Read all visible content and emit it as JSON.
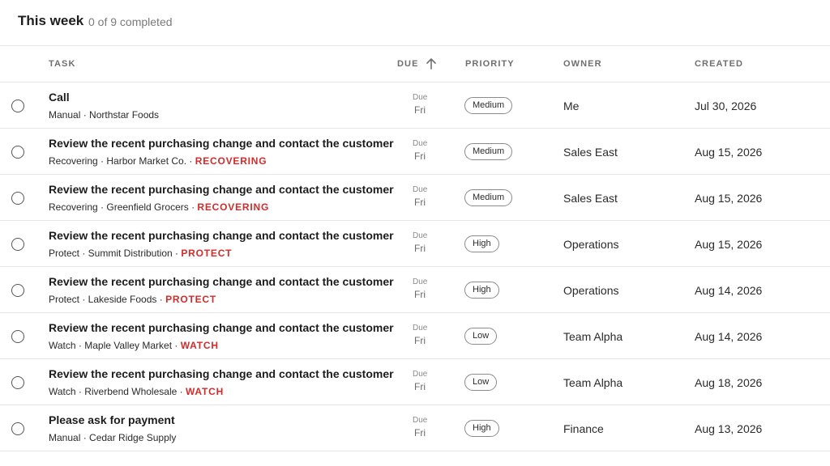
{
  "header": {
    "title": "This week",
    "count": "0 of 9 completed"
  },
  "columns": {
    "task": "TASK",
    "due": "DUE",
    "priority": "PRIORITY",
    "owner": "OWNER",
    "created": "CREATED",
    "sort_icon": "arrow-up-icon"
  },
  "rows": [
    {
      "title": "Call",
      "sub": "Manual · Northstar Foods",
      "tag": "",
      "due_label": "Due",
      "due_day": "Fri",
      "priority": "Medium",
      "owner": "Me",
      "created": "Jul 30, 2026"
    },
    {
      "title": "Review the recent purchasing change and contact the customer",
      "sub": "Recovering · Harbor Market Co. · ",
      "tag": "RECOVERING",
      "due_label": "Due",
      "due_day": "Fri",
      "priority": "Medium",
      "owner": "Sales East",
      "created": "Aug 15, 2026"
    },
    {
      "title": "Review the recent purchasing change and contact the customer",
      "sub": "Recovering · Greenfield Grocers · ",
      "tag": "RECOVERING",
      "due_label": "Due",
      "due_day": "Fri",
      "priority": "Medium",
      "owner": "Sales East",
      "created": "Aug 15, 2026"
    },
    {
      "title": "Review the recent purchasing change and contact the customer",
      "sub": "Protect · Summit Distribution · ",
      "tag": "PROTECT",
      "due_label": "Due",
      "due_day": "Fri",
      "priority": "High",
      "owner": "Operations",
      "created": "Aug 15, 2026"
    },
    {
      "title": "Review the recent purchasing change and contact the customer",
      "sub": "Protect · Lakeside Foods · ",
      "tag": "PROTECT",
      "due_label": "Due",
      "due_day": "Fri",
      "priority": "High",
      "owner": "Operations",
      "created": "Aug 14, 2026"
    },
    {
      "title": "Review the recent purchasing change and contact the customer",
      "sub": "Watch · Maple Valley Market · ",
      "tag": "WATCH",
      "due_label": "Due",
      "due_day": "Fri",
      "priority": "Low",
      "owner": "Team Alpha",
      "created": "Aug 14, 2026"
    },
    {
      "title": "Review the recent purchasing change and contact the customer",
      "sub": "Watch · Riverbend Wholesale · ",
      "tag": "WATCH",
      "due_label": "Due",
      "due_day": "Fri",
      "priority": "Low",
      "owner": "Team Alpha",
      "created": "Aug 18, 2026"
    },
    {
      "title": "Please ask for payment",
      "sub": "Manual · Cedar Ridge Supply",
      "tag": "",
      "due_label": "Due",
      "due_day": "Fri",
      "priority": "High",
      "owner": "Finance",
      "created": "Aug 13, 2026"
    }
  ],
  "colors": {
    "tag": "#d42a2a",
    "divider": "#e6e6e6"
  }
}
